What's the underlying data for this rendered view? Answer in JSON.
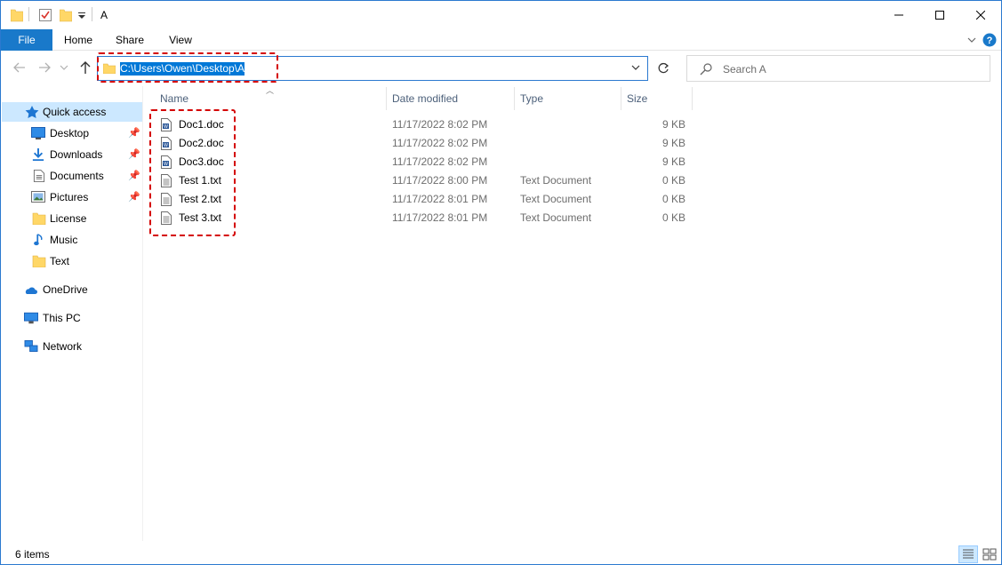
{
  "window": {
    "title": "A"
  },
  "ribbon": {
    "tabs": [
      "File",
      "Home",
      "Share",
      "View"
    ]
  },
  "nav": {
    "address": "C:\\Users\\Owen\\Desktop\\A",
    "search_placeholder": "Search A"
  },
  "sidebar": {
    "quick_access": "Quick access",
    "pinned": [
      {
        "label": "Desktop",
        "icon": "desktop-icon",
        "pinned": true
      },
      {
        "label": "Downloads",
        "icon": "download-icon",
        "pinned": true
      },
      {
        "label": "Documents",
        "icon": "documents-icon",
        "pinned": true
      },
      {
        "label": "Pictures",
        "icon": "pictures-icon",
        "pinned": true
      },
      {
        "label": "License",
        "icon": "folder-icon",
        "pinned": false
      },
      {
        "label": "Music",
        "icon": "music-icon",
        "pinned": false
      },
      {
        "label": "Text",
        "icon": "folder-icon",
        "pinned": false
      }
    ],
    "onedrive": "OneDrive",
    "thispc": "This PC",
    "network": "Network"
  },
  "columns": {
    "name": "Name",
    "date": "Date modified",
    "type": "Type",
    "size": "Size"
  },
  "files": [
    {
      "name": "Doc1.doc",
      "date": "11/17/2022 8:02 PM",
      "type": "",
      "size": "9 KB",
      "icon": "word-doc-icon"
    },
    {
      "name": "Doc2.doc",
      "date": "11/17/2022 8:02 PM",
      "type": "",
      "size": "9 KB",
      "icon": "word-doc-icon"
    },
    {
      "name": "Doc3.doc",
      "date": "11/17/2022 8:02 PM",
      "type": "",
      "size": "9 KB",
      "icon": "word-doc-icon"
    },
    {
      "name": "Test 1.txt",
      "date": "11/17/2022 8:00 PM",
      "type": "Text Document",
      "size": "0 KB",
      "icon": "text-file-icon"
    },
    {
      "name": "Test 2.txt",
      "date": "11/17/2022 8:01 PM",
      "type": "Text Document",
      "size": "0 KB",
      "icon": "text-file-icon"
    },
    {
      "name": "Test 3.txt",
      "date": "11/17/2022 8:01 PM",
      "type": "Text Document",
      "size": "0 KB",
      "icon": "text-file-icon"
    }
  ],
  "status": {
    "items": "6 items"
  },
  "colors": {
    "accent": "#0078d7",
    "file_tab": "#1979ca",
    "selected": "#cce8ff",
    "highlight": "#d40000"
  }
}
